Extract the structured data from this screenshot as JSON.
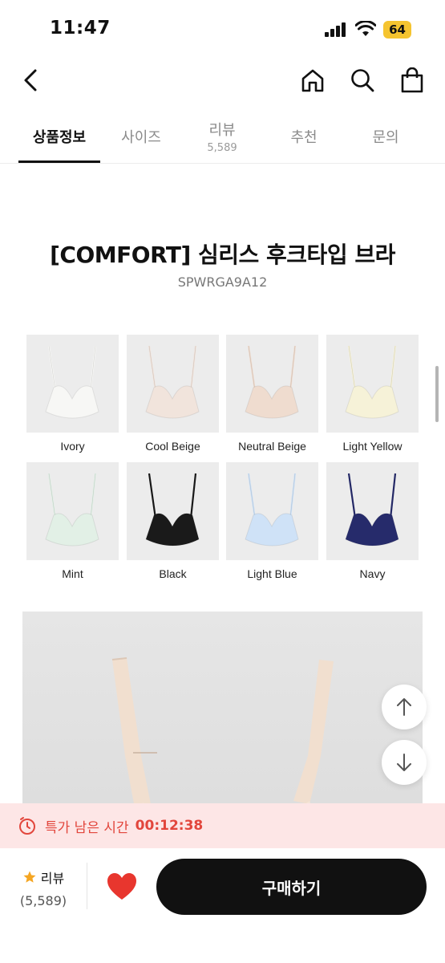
{
  "status": {
    "time": "11:47",
    "battery": "64"
  },
  "nav": {
    "back_icon": "chevron-left-icon",
    "home_icon": "home-icon",
    "search_icon": "search-icon",
    "cart_icon": "shopping-bag-icon"
  },
  "tabs": [
    {
      "label": "상품정보",
      "count": ""
    },
    {
      "label": "사이즈",
      "count": ""
    },
    {
      "label": "리뷰",
      "count": "5,589"
    },
    {
      "label": "추천",
      "count": ""
    },
    {
      "label": "문의",
      "count": ""
    }
  ],
  "product": {
    "title": "[COMFORT] 심리스 후크타입 브라",
    "code": "SPWRGA9A12",
    "colors": [
      {
        "name": "Ivory",
        "color": "#f7f7f5"
      },
      {
        "name": "Cool Beige",
        "color": "#f1e4dc"
      },
      {
        "name": "Neutral Beige",
        "color": "#efdccf"
      },
      {
        "name": "Light Yellow",
        "color": "#f6f2d8"
      },
      {
        "name": "Mint",
        "color": "#e2f0e6"
      },
      {
        "name": "Black",
        "color": "#1a1a1a"
      },
      {
        "name": "Light Blue",
        "color": "#cfe2f7"
      },
      {
        "name": "Navy",
        "color": "#262b6b"
      }
    ]
  },
  "timer": {
    "label": "특가 남은 시간",
    "value": "00:12:38"
  },
  "bottom": {
    "review_label": "리뷰",
    "review_count": "(5,589)",
    "buy_label": "구매하기"
  },
  "colors": {
    "accent_red": "#e2463c",
    "banner_bg": "#fde6e6",
    "star": "#f5a623",
    "heart": "#e8362e",
    "buy_bg": "#111111"
  }
}
